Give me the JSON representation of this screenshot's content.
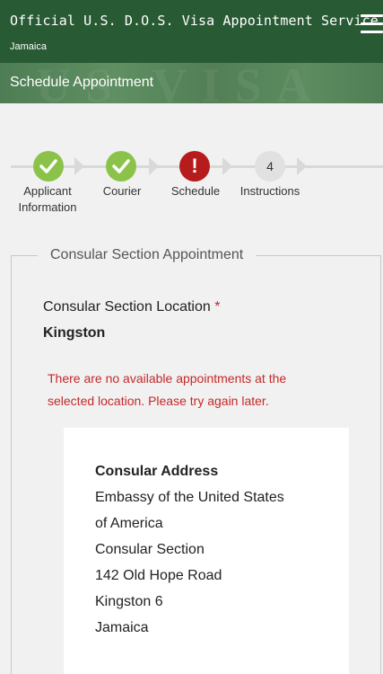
{
  "header": {
    "title": "Official U.S. D.O.S. Visa Appointment Service",
    "subtitle": "Jamaica",
    "banner_label": "Schedule Appointment",
    "banner_watermark": "US VISA"
  },
  "steps": [
    {
      "label_line1": "Applicant",
      "label_line2": "Information",
      "status": "complete"
    },
    {
      "label_line1": "Courier",
      "label_line2": "",
      "status": "complete"
    },
    {
      "label_line1": "Schedule",
      "label_line2": "",
      "status": "error",
      "icon_text": "!"
    },
    {
      "label_line1": "Instructions",
      "label_line2": "",
      "status": "pending",
      "icon_text": "4"
    }
  ],
  "section": {
    "legend": "Consular Section Appointment",
    "location_label": "Consular Section Location",
    "required_mark": "*",
    "location_value": "Kingston",
    "error_message": "There are no available appointments at the selected location. Please try again later."
  },
  "address": {
    "title": "Consular Address",
    "lines": [
      "Embassy of the United States",
      "of America",
      "Consular Section",
      "142 Old Hope Road",
      "Kingston 6",
      "Jamaica"
    ]
  },
  "colors": {
    "header_bg": "#285a33",
    "step_complete": "#8bc34a",
    "step_error": "#b71c1c",
    "error_text": "#c62828"
  }
}
